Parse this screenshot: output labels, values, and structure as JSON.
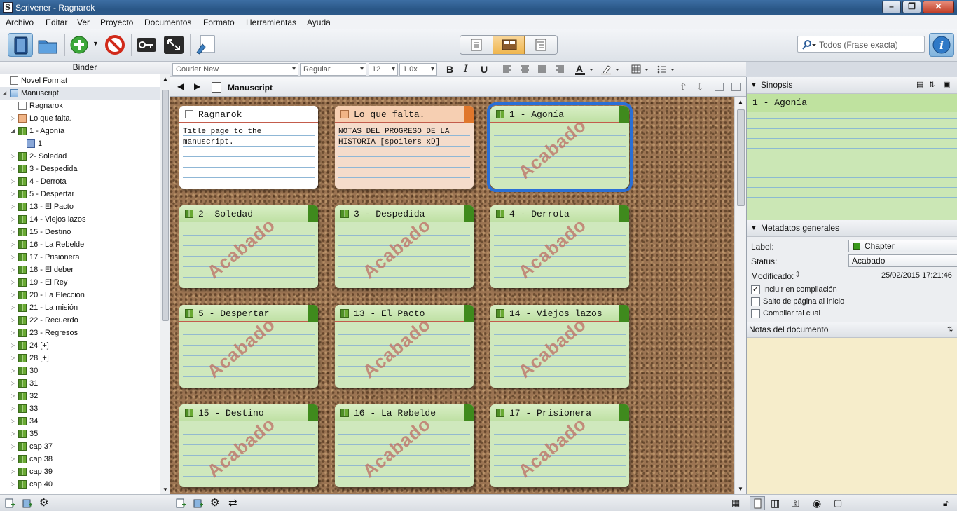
{
  "window": {
    "title": "Scrivener - Ragnarok"
  },
  "menu": [
    "Archivo",
    "Editar",
    "Ver",
    "Proyecto",
    "Documentos",
    "Formato",
    "Herramientas",
    "Ayuda"
  ],
  "search": {
    "placeholder": "Todos (Frase exacta)"
  },
  "binder": {
    "header": "Binder",
    "items": [
      {
        "label": "Novel Format",
        "level": 0,
        "icon": "doc",
        "expander": "none"
      },
      {
        "label": "Manuscript",
        "level": 0,
        "icon": "folder-blue",
        "expander": "open",
        "selected": true
      },
      {
        "label": "Ragnarok",
        "level": 1,
        "icon": "doc",
        "expander": "none"
      },
      {
        "label": "Lo que falta.",
        "level": 1,
        "icon": "doc-or",
        "expander": "closed"
      },
      {
        "label": "1 - Agonía",
        "level": 1,
        "icon": "folder-book",
        "expander": "open"
      },
      {
        "label": "1",
        "level": 2,
        "icon": "doc-blue",
        "expander": "none"
      },
      {
        "label": "2- Soledad",
        "level": 1,
        "icon": "folder-book",
        "expander": "closed"
      },
      {
        "label": "3 - Despedida",
        "level": 1,
        "icon": "folder-book",
        "expander": "closed"
      },
      {
        "label": "4 - Derrota",
        "level": 1,
        "icon": "folder-book",
        "expander": "closed"
      },
      {
        "label": "5 - Despertar",
        "level": 1,
        "icon": "folder-book",
        "expander": "closed"
      },
      {
        "label": "13 - El Pacto",
        "level": 1,
        "icon": "folder-book",
        "expander": "closed"
      },
      {
        "label": "14 - Viejos lazos",
        "level": 1,
        "icon": "folder-book",
        "expander": "closed"
      },
      {
        "label": "15 - Destino",
        "level": 1,
        "icon": "folder-book",
        "expander": "closed"
      },
      {
        "label": "16 - La Rebelde",
        "level": 1,
        "icon": "folder-book",
        "expander": "closed"
      },
      {
        "label": "17 - Prisionera",
        "level": 1,
        "icon": "folder-book",
        "expander": "closed"
      },
      {
        "label": "18 - El deber",
        "level": 1,
        "icon": "folder-book",
        "expander": "closed"
      },
      {
        "label": "19 - El Rey",
        "level": 1,
        "icon": "folder-book",
        "expander": "closed"
      },
      {
        "label": "20 - La Elección",
        "level": 1,
        "icon": "folder-book",
        "expander": "closed"
      },
      {
        "label": "21 - La misión",
        "level": 1,
        "icon": "folder-book",
        "expander": "closed"
      },
      {
        "label": "22 - Recuerdo",
        "level": 1,
        "icon": "folder-book",
        "expander": "closed"
      },
      {
        "label": "23 - Regresos",
        "level": 1,
        "icon": "folder-book",
        "expander": "closed"
      },
      {
        "label": "24 [+]",
        "level": 1,
        "icon": "folder-book",
        "expander": "closed"
      },
      {
        "label": "28 [+]",
        "level": 1,
        "icon": "folder-book",
        "expander": "closed"
      },
      {
        "label": "30",
        "level": 1,
        "icon": "folder-book",
        "expander": "closed"
      },
      {
        "label": "31",
        "level": 1,
        "icon": "folder-book",
        "expander": "closed"
      },
      {
        "label": "32",
        "level": 1,
        "icon": "folder-book",
        "expander": "closed"
      },
      {
        "label": "33",
        "level": 1,
        "icon": "folder-book",
        "expander": "closed"
      },
      {
        "label": "34",
        "level": 1,
        "icon": "folder-book",
        "expander": "closed"
      },
      {
        "label": "35",
        "level": 1,
        "icon": "folder-book",
        "expander": "closed"
      },
      {
        "label": "cap 37",
        "level": 1,
        "icon": "folder-book",
        "expander": "closed"
      },
      {
        "label": "cap 38",
        "level": 1,
        "icon": "folder-book",
        "expander": "closed"
      },
      {
        "label": "cap 39",
        "level": 1,
        "icon": "folder-book",
        "expander": "closed"
      },
      {
        "label": "cap 40",
        "level": 1,
        "icon": "folder-book",
        "expander": "closed"
      }
    ]
  },
  "format": {
    "font": "Courier New",
    "style": "Regular",
    "size": "12",
    "spacing": "1.0x",
    "bold": "B",
    "italic": "I",
    "underline": "U"
  },
  "editor": {
    "title": "Manuscript"
  },
  "corkboard": {
    "stamp": "Acabado",
    "cards": [
      {
        "title": "Ragnarok",
        "synopsis": "Title page to the manuscript.",
        "style": "white",
        "icon": "doc",
        "stamped": false
      },
      {
        "title": "Lo que falta.",
        "synopsis": "NOTAS DEL PROGRESO DE LA HISTORIA [spoilers xD]",
        "style": "orange",
        "icon": "doc-or",
        "stamped": false
      },
      {
        "title": "1 - Agonía",
        "synopsis": "",
        "style": "green",
        "icon": "folder-book",
        "stamped": true,
        "selected": true
      },
      {
        "title": "2- Soledad",
        "synopsis": "",
        "style": "green",
        "icon": "folder-book",
        "stamped": true
      },
      {
        "title": "3 - Despedida",
        "synopsis": "",
        "style": "green",
        "icon": "folder-book",
        "stamped": true
      },
      {
        "title": "4 - Derrota",
        "synopsis": "",
        "style": "green",
        "icon": "folder-book",
        "stamped": true
      },
      {
        "title": "5 - Despertar",
        "synopsis": "",
        "style": "green",
        "icon": "folder-book",
        "stamped": true
      },
      {
        "title": "13 - El Pacto",
        "synopsis": "",
        "style": "green",
        "icon": "folder-book",
        "stamped": true
      },
      {
        "title": "14 - Viejos lazos",
        "synopsis": "",
        "style": "green",
        "icon": "folder-book",
        "stamped": true
      },
      {
        "title": "15 - Destino",
        "synopsis": "",
        "style": "green",
        "icon": "folder-book",
        "stamped": true
      },
      {
        "title": "16 - La Rebelde",
        "synopsis": "",
        "style": "green",
        "icon": "folder-book",
        "stamped": true
      },
      {
        "title": "17 - Prisionera",
        "synopsis": "",
        "style": "green",
        "icon": "folder-book",
        "stamped": true
      }
    ]
  },
  "inspector": {
    "synopsis_header": "Sinopsis",
    "synopsis_title": "1 - Agonía",
    "metadata_header": "Metadatos generales",
    "label_caption": "Label:",
    "label_value": "Chapter",
    "label_color": "#3a9a1c",
    "status_caption": "Status:",
    "status_value": "Acabado",
    "modified_caption": "Modificado:",
    "modified_value": "25/02/2015 17:21:46",
    "checks": [
      {
        "label": "Incluir en compilación",
        "checked": true
      },
      {
        "label": "Salto de página al inicio",
        "checked": false
      },
      {
        "label": "Compilar tal cual",
        "checked": false
      }
    ],
    "notes_header": "Notas del documento"
  },
  "colors": {
    "accent": "#2a6fd6",
    "label_green": "#3f8a1d",
    "label_orange": "#e0772c"
  }
}
